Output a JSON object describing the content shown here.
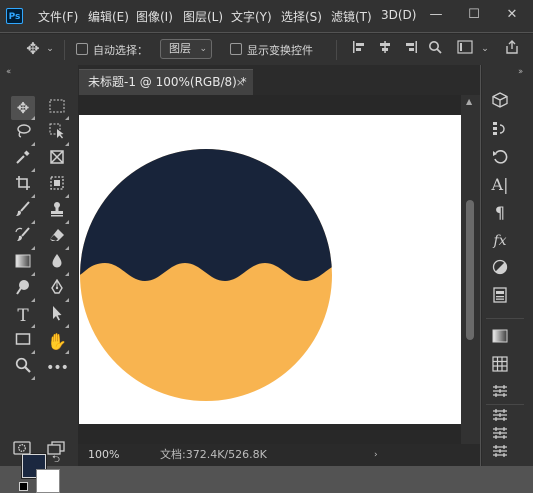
{
  "app": {
    "logo_text": "Ps",
    "menu": [
      "文件(F)",
      "编辑(E)",
      "图像(I)",
      "图层(L)",
      "文字(Y)",
      "选择(S)",
      "滤镜(T)",
      "3D(D)"
    ],
    "window_controls": {
      "minimize": "—",
      "maximize": "☐",
      "close": "✕"
    }
  },
  "options_bar": {
    "auto_select_label": "自动选择：",
    "auto_select_target": "图层",
    "show_transform_label": "显示变换控件"
  },
  "document": {
    "tab_title": "未标题-1 @ 100%(RGB/8) *",
    "tab_close": "×",
    "artwork": {
      "top_color": "#18243a",
      "bottom_color": "#f8b450",
      "background": "#ffffff"
    }
  },
  "status": {
    "zoom": "100%",
    "doc_info": "文档:372.4K/526.8K",
    "arrow": "›"
  },
  "colors": {
    "foreground": "#1b2840",
    "background": "#ffffff",
    "accent": "#31a8ff"
  },
  "tools": [
    "move-tool",
    "marquee-tool",
    "lasso-tool",
    "object-select-tool",
    "eyedropper-tool",
    "frame-tool",
    "crop-tool",
    "patch-tool",
    "brush-tool",
    "stamp-tool",
    "history-brush-tool",
    "eraser-tool",
    "gradient-tool",
    "blur-tool",
    "dodge-tool",
    "pen-tool",
    "type-tool",
    "path-select-tool",
    "shape-tool",
    "hand-tool",
    "zoom-tool",
    "more-tools"
  ],
  "right_panel_icons": [
    "3d-icon",
    "history-icon",
    "actions-icon",
    "character-icon",
    "paragraph-icon",
    "fx-icon",
    "adjustments-icon",
    "properties-icon",
    "gradients-icon",
    "swatches-icon",
    "patterns-icon",
    "layers-icon",
    "channels-icon",
    "paths-icon"
  ]
}
